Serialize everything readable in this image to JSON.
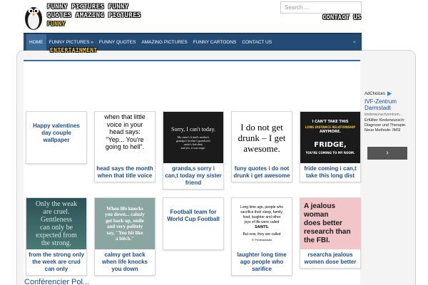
{
  "header": {
    "logo_line1": "FUNNY PICTURES FUNNY",
    "logo_line2": "QUOTES AMAZING PICTURES",
    "logo_line3": "FUNNY",
    "search_placeholder": "Search ...",
    "contact": "CONTACT US",
    "sub_logo": "ENTERTAINMENT"
  },
  "nav": {
    "items": [
      {
        "label": "HOME"
      },
      {
        "label": "FUNNY PICTURES »"
      },
      {
        "label": "FUNNY QUOTES"
      },
      {
        "label": "AMAZING PICTURES"
      },
      {
        "label": "FUNNY CARTOONS"
      },
      {
        "label": "CONTACT US"
      }
    ],
    "toggle": "«"
  },
  "ad": {
    "choices": "AdChoices",
    "title": "IVF-Zentrum Darmstadt",
    "url": "kinderwunschzentrum...",
    "desc": "Erfüllter Kinderwunsch: Diagnose und Therapie. Neue Methode: IMSI",
    "arrow": "›"
  },
  "cards": [
    {
      "caption": "Happy valentines day couple wallpaper",
      "thumb": {
        "lines": []
      }
    },
    {
      "caption": "head says the month when that title voice",
      "thumb": {
        "lines": [
          "when that little",
          "voice in your",
          "head says:",
          "\"Yep... You're",
          "going to hell\"."
        ]
      }
    },
    {
      "caption": "granda,s sorry i can,t today my sister friend",
      "thumb": {
        "lines": [
          "Sorry, I can't today.",
          "My sister's friend's mother's",
          "grandpa's brother's grandson's",
          "uncle's fish died,",
          "and yes, it was tragic."
        ]
      }
    },
    {
      "caption": "funy quotes i do not drunk i get awesome",
      "thumb": {
        "lines": [
          "I do not get",
          "drunk – I get",
          "awesome."
        ]
      }
    },
    {
      "caption": "fride coming i can,t take this long dist",
      "thumb": {
        "lines": [
          "I CAN'T TAKE THIS",
          "LONG DISTANCE RELATIONSHIP",
          "ANYMORE.",
          "FRIDGE,",
          "YOU'RE COMING TO MY ROOM."
        ]
      }
    },
    {
      "caption": "from the strong only the week are crud can only",
      "thumb": {
        "lines": [
          "Only the weak",
          "are cruel.",
          "Gentleness",
          "can only be",
          "expected from",
          "the strong."
        ]
      }
    },
    {
      "caption": "calmy get back when life knocks you down",
      "thumb": {
        "lines": [
          "When life knocks",
          "you down... calmly",
          "get back up, smile",
          "and very politely",
          "say, \"You hit like",
          "a bitch.\""
        ]
      }
    },
    {
      "caption": "Football team for World Cup Football",
      "thumb": {
        "lines": []
      }
    },
    {
      "caption": "laughter long time ago people who sarifice",
      "thumb": {
        "lines": [
          "Long time ago, people who",
          "sacrifice their sleep, family,",
          "food, laughter and other",
          "joys of life were called",
          "SAINTS.",
          "But now, they are called",
          "IT Professionals"
        ]
      }
    },
    {
      "caption": "rsearcha jealous women dose better",
      "thumb": {
        "lines": [
          "A jealous woman",
          "does better",
          "research than",
          "the FBI."
        ]
      }
    }
  ],
  "bottom_text": "Conférencier Pol..."
}
